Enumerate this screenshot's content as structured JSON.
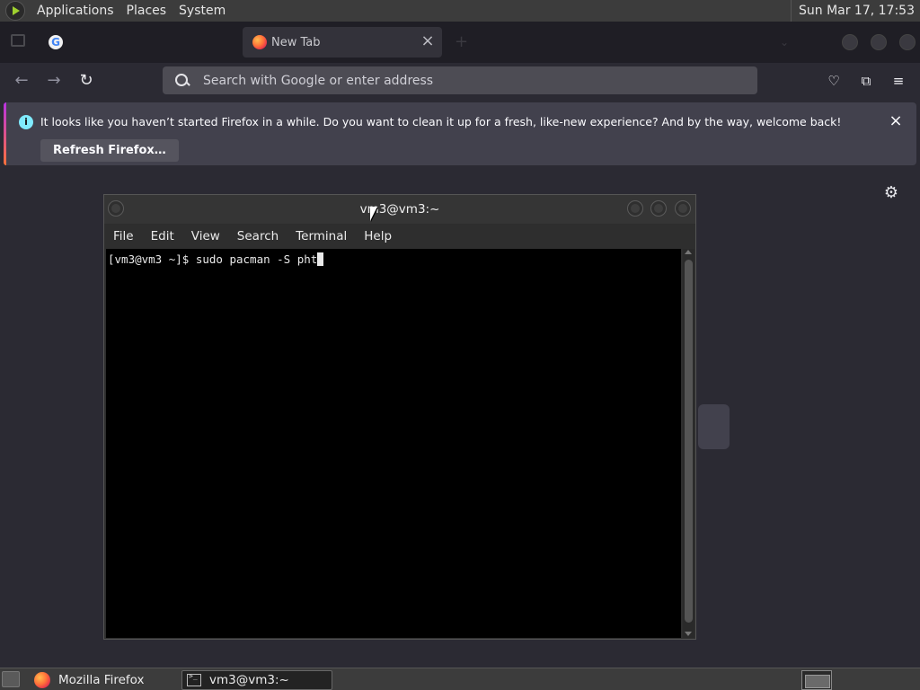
{
  "top_panel": {
    "menus": [
      "Applications",
      "Places",
      "System"
    ],
    "clock": "Sun Mar 17, 17:53"
  },
  "firefox": {
    "tabs": [
      {
        "title": "",
        "favicon": "google-favicon",
        "active": false
      },
      {
        "title": "New Tab",
        "favicon": "firefox-favicon",
        "active": true
      }
    ],
    "urlbar": {
      "placeholder": "Search with Google or enter address",
      "value": ""
    },
    "notification": {
      "message": "It looks like you haven’t started Firefox in a while. Do you want to clean it up for a fresh, like-new experience? And by the way, welcome back!",
      "button_label": "Refresh Firefox…"
    },
    "colors": {
      "accent": "#80ebff",
      "toolbar": "#2b2a33",
      "urlbar": "#4d4c54"
    }
  },
  "terminal": {
    "title": "vm3@vm3:~",
    "menu": [
      "File",
      "Edit",
      "View",
      "Search",
      "Terminal",
      "Help"
    ],
    "prompt": "[vm3@vm3 ~]$ ",
    "command": "sudo pacman -S pht"
  },
  "taskbar": {
    "tasks": [
      {
        "label": "Mozilla Firefox",
        "icon": "firefox-icon"
      },
      {
        "label": "vm3@vm3:~",
        "icon": "terminal-icon"
      }
    ]
  }
}
